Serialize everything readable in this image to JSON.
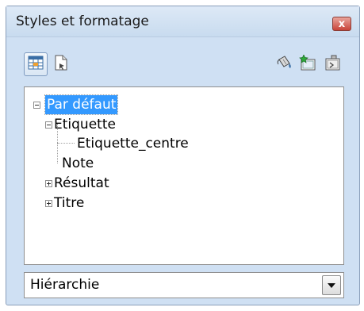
{
  "window": {
    "title": "Styles et formatage",
    "close_glyph": "x"
  },
  "toolbar": {
    "buttons": [
      {
        "icon": "cell-styles-icon",
        "pressed": true
      },
      {
        "icon": "page-styles-icon",
        "pressed": false
      },
      {
        "icon": "fill-format-mode-icon",
        "pressed": false
      },
      {
        "icon": "new-style-from-selection-icon",
        "pressed": false
      },
      {
        "icon": "update-style-icon",
        "pressed": false
      }
    ]
  },
  "tree": {
    "items": [
      {
        "label": "Par défaut",
        "expander": "minus",
        "selected": true
      },
      {
        "label": "Etiquette",
        "expander": "minus",
        "selected": false
      },
      {
        "label": "Etiquette_centre",
        "expander": "none",
        "selected": false
      },
      {
        "label": "Note",
        "expander": "none",
        "selected": false
      },
      {
        "label": "Résultat",
        "expander": "plus",
        "selected": false
      },
      {
        "label": "Titre",
        "expander": "plus",
        "selected": false
      }
    ]
  },
  "filter": {
    "selected": "Hiérarchie"
  },
  "colors": {
    "selection": "#3399ff",
    "window_bg": "#cfe0f3",
    "close_button": "#c8443a"
  }
}
